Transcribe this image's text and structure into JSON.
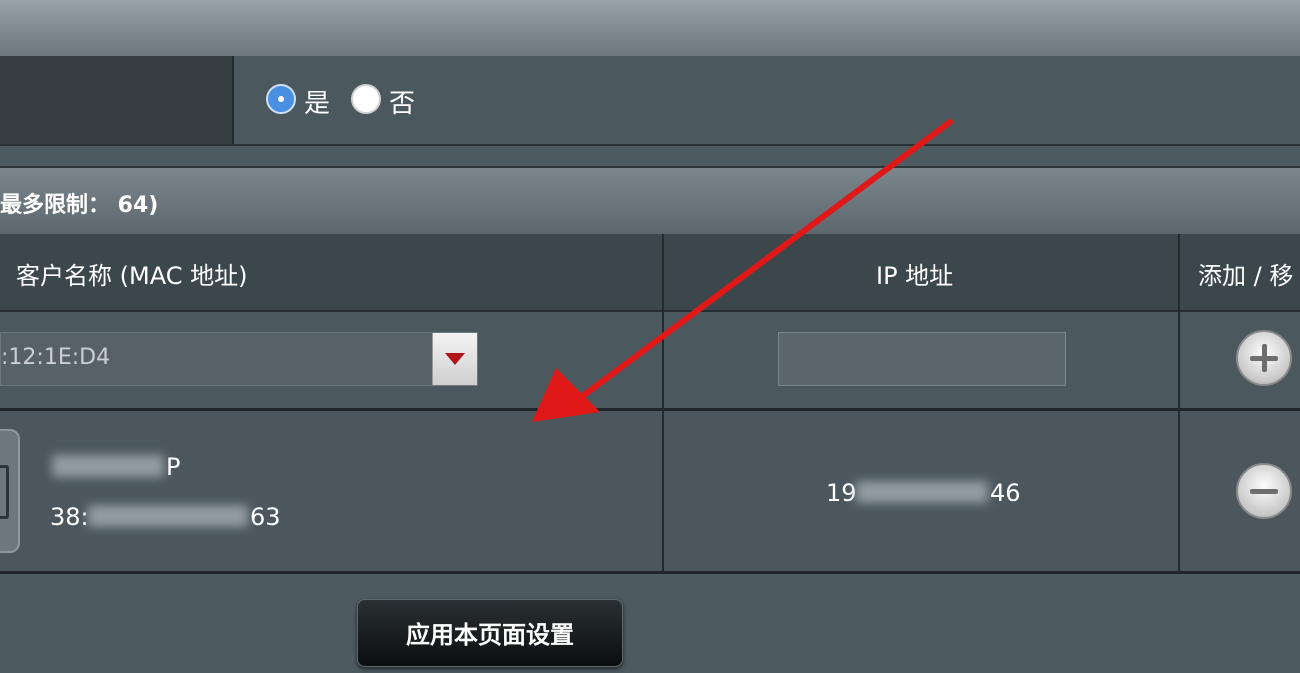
{
  "option_row": {
    "options": [
      {
        "label": "是",
        "selected": true
      },
      {
        "label": "否",
        "selected": false
      }
    ]
  },
  "section": {
    "title": "最多限制： 64)"
  },
  "table": {
    "headers": {
      "client": "客户名称 (MAC 地址)",
      "ip": "IP 地址",
      "action": "添加 / 移"
    },
    "input_row": {
      "mac_select_value": ":12:1E:D4",
      "ip_value": "",
      "add_icon": "plus-circle-icon"
    },
    "clients": [
      {
        "name_visible": "P",
        "mac_prefix": "38:",
        "mac_suffix": "63",
        "ip_prefix": "19",
        "ip_suffix": "46",
        "remove_icon": "minus-circle-icon"
      }
    ]
  },
  "footer": {
    "apply_label": "应用本页面设置"
  },
  "colors": {
    "selected_radio": "#4a90e2",
    "dropdown_arrow": "#b0151a",
    "annotation_arrow": "#e01818"
  }
}
